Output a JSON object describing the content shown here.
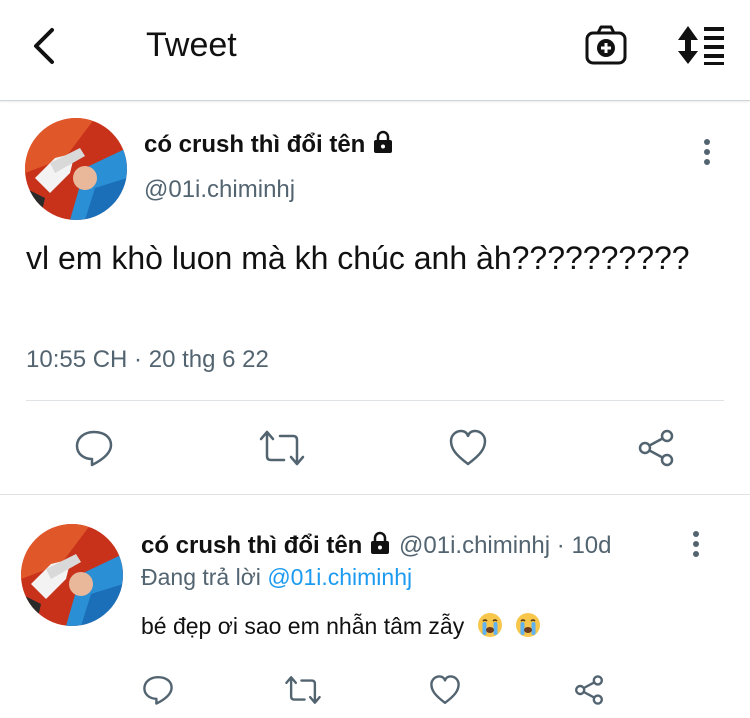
{
  "header": {
    "title": "Tweet",
    "back_icon": "chevron-left-icon",
    "camera_icon": "camera-plus-icon",
    "sort_icon": "sort-list-icon"
  },
  "main_tweet": {
    "display_name": "có crush thì đổi tên",
    "handle": "@01i.chiminhj",
    "text": "vl em khò luon mà kh chúc anh àh??????????",
    "timestamp": "10:55 CH · 20 thg 6 22",
    "actions": [
      "reply-icon",
      "retweet-icon",
      "like-icon",
      "share-icon"
    ]
  },
  "reply_tweet": {
    "display_name": "có crush thì đổi tên",
    "handle": "@01i.chiminhj",
    "age": "· 10d",
    "replying_prefix": "Đang trả lời",
    "replying_to": "@01i.chiminhj",
    "text": "bé đẹp ơi sao em nhẫn tâm zẫy",
    "emojis": [
      "crying-face-icon",
      "crying-face-icon"
    ],
    "actions": [
      "reply-icon",
      "retweet-icon",
      "like-icon",
      "share-icon"
    ]
  },
  "colors": {
    "text": "#111111",
    "secondary": "#536471",
    "link": "#1d9bf0",
    "divider": "#dfe3e6"
  }
}
